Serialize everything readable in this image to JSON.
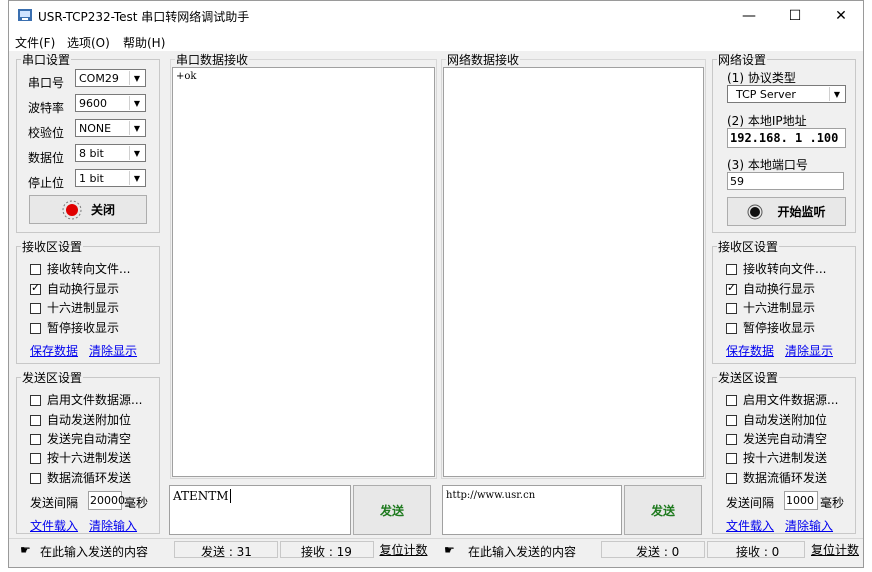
{
  "window": {
    "title": "USR-TCP232-Test 串口转网络调试助手",
    "minimize": "—",
    "maximize": "☐",
    "close": "✕"
  },
  "menu": [
    "文件(F)",
    "选项(O)",
    "帮助(H)"
  ],
  "serial_settings": {
    "title": "串口设置",
    "rows": [
      {
        "label": "串口号",
        "value": "COM29"
      },
      {
        "label": "波特率",
        "value": "9600"
      },
      {
        "label": "校验位",
        "value": "NONE"
      },
      {
        "label": "数据位",
        "value": "8 bit"
      },
      {
        "label": "停止位",
        "value": "1 bit"
      }
    ],
    "button": "关闭",
    "status_color": "#e00000"
  },
  "left_receive": {
    "title": "接收区设置",
    "options": [
      {
        "label": "接收转向文件...",
        "checked": false
      },
      {
        "label": "自动换行显示",
        "checked": true
      },
      {
        "label": "十六进制显示",
        "checked": false
      },
      {
        "label": "暂停接收显示",
        "checked": false
      }
    ],
    "save": "保存数据",
    "clear": "清除显示"
  },
  "left_send": {
    "title": "发送区设置",
    "options": [
      {
        "label": "启用文件数据源...",
        "checked": false
      },
      {
        "label": "自动发送附加位",
        "checked": false
      },
      {
        "label": "发送完自动清空",
        "checked": false
      },
      {
        "label": "按十六进制发送",
        "checked": false
      },
      {
        "label": "数据流循环发送",
        "checked": false
      }
    ],
    "interval_label": "发送间隔",
    "interval_value": "20000",
    "interval_unit": "毫秒",
    "load": "文件载入",
    "clear": "清除输入"
  },
  "serial_receive": {
    "title": "串口数据接收",
    "content": "+ok"
  },
  "net_receive": {
    "title": "网络数据接收",
    "content": ""
  },
  "serial_send": {
    "content": "ATENTM",
    "button": "发送"
  },
  "net_send": {
    "content": "http://www.usr.cn",
    "button": "发送"
  },
  "net_settings": {
    "title": "网络设置",
    "protocol_label": "(1) 协议类型",
    "protocol_value": "TCP Server",
    "ip_label": "(2) 本地IP地址",
    "ip_value": "192.168. 1 .100",
    "port_label": "(3) 本地端口号",
    "port_value": "59",
    "button": "开始监听"
  },
  "right_receive": {
    "title": "接收区设置",
    "options": [
      {
        "label": "接收转向文件...",
        "checked": false
      },
      {
        "label": "自动换行显示",
        "checked": true
      },
      {
        "label": "十六进制显示",
        "checked": false
      },
      {
        "label": "暂停接收显示",
        "checked": false
      }
    ],
    "save": "保存数据",
    "clear": "清除显示"
  },
  "right_send": {
    "title": "发送区设置",
    "options": [
      {
        "label": "启用文件数据源...",
        "checked": false
      },
      {
        "label": "自动发送附加位",
        "checked": false
      },
      {
        "label": "发送完自动清空",
        "checked": false
      },
      {
        "label": "按十六进制发送",
        "checked": false
      },
      {
        "label": "数据流循环发送",
        "checked": false
      }
    ],
    "interval_label": "发送间隔",
    "interval_value": "1000",
    "interval_unit": "毫秒",
    "load": "文件载入",
    "clear": "清除输入"
  },
  "status_left": {
    "hint": "在此输入发送的内容",
    "send": "发送 : 31",
    "recv": "接收 : 19",
    "reset": "复位计数"
  },
  "status_right": {
    "hint": "在此输入发送的内容",
    "send": "发送 : 0",
    "recv": "接收 : 0",
    "reset": "复位计数"
  }
}
